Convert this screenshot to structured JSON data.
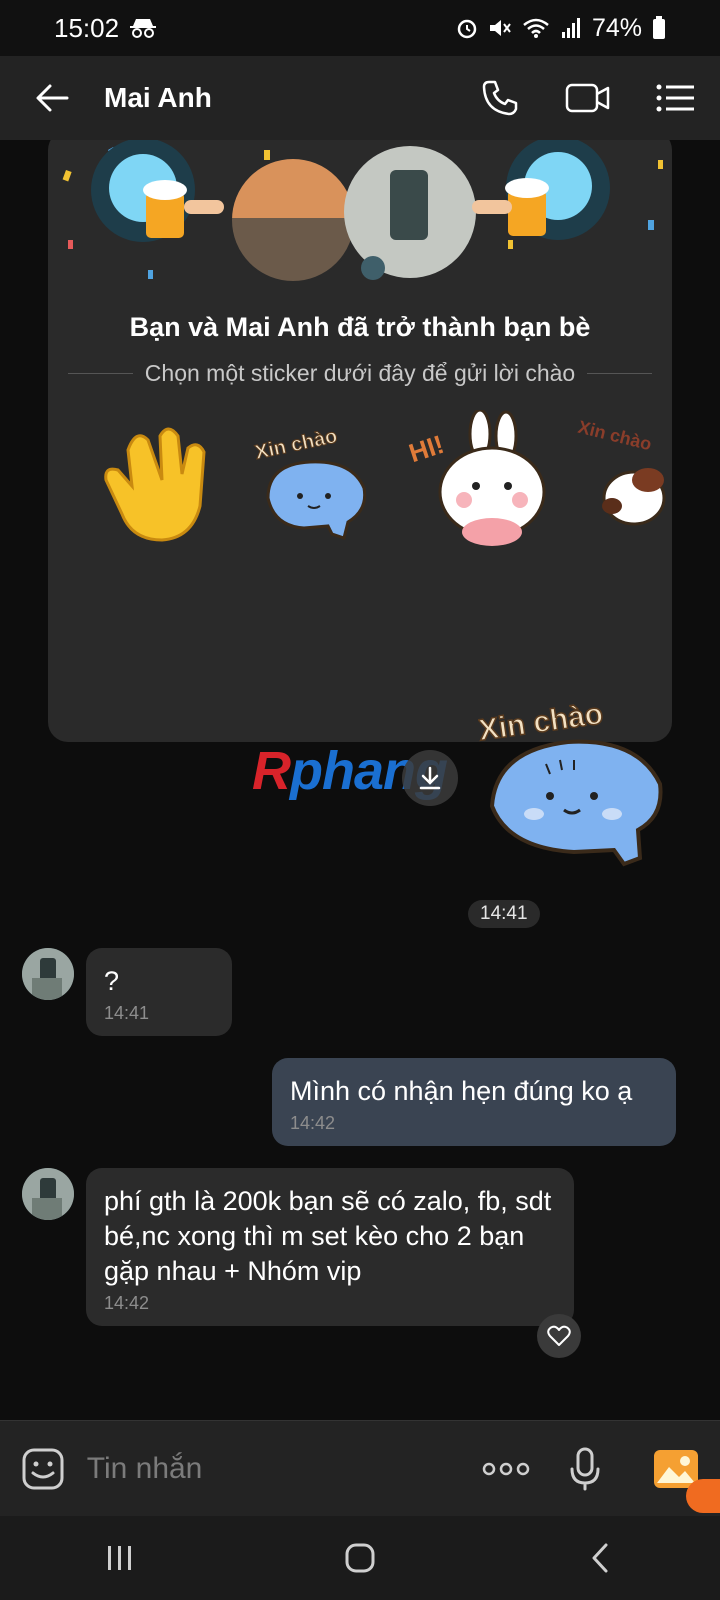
{
  "status_bar": {
    "time": "15:02",
    "battery": "74%"
  },
  "header": {
    "title": "Mai Anh"
  },
  "friend_card": {
    "title": "Bạn và Mai Anh đã trở thành bạn bè",
    "subtitle": "Chọn một sticker dưới đây để gửi lời chào",
    "sticker_texts": [
      "Xin chào",
      "HI!",
      "Xin chào"
    ]
  },
  "sent_sticker": {
    "text": "Xin chào"
  },
  "watermark": {
    "part1": "R",
    "part2": "phang"
  },
  "time_separator": "14:41",
  "messages": [
    {
      "direction": "in",
      "text": "?",
      "time": "14:41"
    },
    {
      "direction": "out",
      "text": "Mình có nhận hẹn đúng ko ạ",
      "time": "14:42"
    },
    {
      "direction": "in",
      "text": "phí gth là 200k bạn sẽ có zalo, fb, sdt bé,nc xong thì m set kèo cho 2 bạn gặp nhau + Nhóm vip",
      "time": "14:42"
    }
  ],
  "composer": {
    "placeholder": "Tin nhắn"
  },
  "colors": {
    "accent_orange": "#f06b20",
    "bubble_in": "#2b2b2b",
    "bubble_out": "#3a4452",
    "card_bg": "#2a2a2a"
  },
  "icons": [
    "incognito-icon",
    "alarm-icon",
    "mute-icon",
    "wifi-icon",
    "signal-icon",
    "battery-icon",
    "back-arrow-icon",
    "phone-icon",
    "video-icon",
    "list-menu-icon",
    "download-icon",
    "heart-icon",
    "emoji-icon",
    "more-dots-icon",
    "mic-icon",
    "image-icon",
    "recents-icon",
    "home-icon",
    "nav-back-icon"
  ]
}
